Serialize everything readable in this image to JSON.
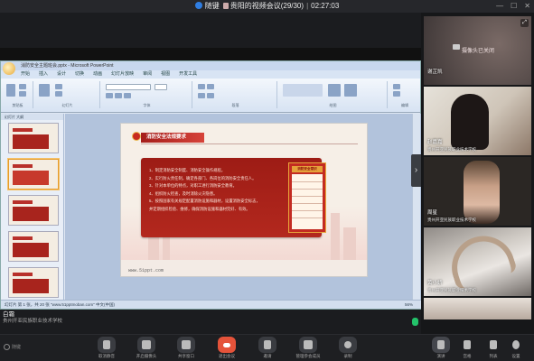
{
  "window": {
    "app_name": "随键",
    "meeting_title": "贵阳的视频会议(29/30)",
    "separator": "|",
    "elapsed": "02:27:03"
  },
  "ppt": {
    "title_text": "消防安全主题班会.pptx - Microsoft PowerPoint",
    "tabs": [
      "开始",
      "插入",
      "设计",
      "切换",
      "动画",
      "幻灯片放映",
      "审阅",
      "视图",
      "开发工具"
    ],
    "ribbon_groups": [
      "剪贴板",
      "幻灯片",
      "字体",
      "段落",
      "绘图",
      "编辑"
    ],
    "panel_tabs": "幻灯片  大纲",
    "status_left": "幻灯片 第 1 张，共 20 张   \"www.51pptmoban.com\"   中文(中国)",
    "status_zoom": "56%",
    "slide": {
      "title": "消防安全法规要求",
      "lines": [
        "1、制定消防安全制度、消防安全操作规程。",
        "2、实行防火责任制，确定各部门、各岗位的消防安全责任人。",
        "3、针对本单位的特点，对职工进行消防安全教育。",
        "4、组织防火检查，及时消除火灾隐患。",
        "5、按照国家有关规定配置消防设施和器材，设置消防安全标志，",
        "并定期组织检验、维修，确保消防设施和器材完好、有效。"
      ],
      "side_title": "消防安全常识",
      "url": "www.51ppt.com"
    }
  },
  "self_view": {
    "name": "白霜",
    "org": "贵州开亚民族职业技术学校"
  },
  "participants": [
    {
      "name": "谢芷凯",
      "org": "",
      "status": "摄像头已关闭"
    },
    {
      "name": "赵嘉嘉",
      "org": "贵州开亚民族职业技术学校",
      "status": ""
    },
    {
      "name": "周星",
      "org": "贵州开亚民族职业技术学校",
      "status": ""
    },
    {
      "name": "黄小娇",
      "org": "贵州开亚民族职业技术学校",
      "status": ""
    },
    {
      "name": "",
      "org": "",
      "status": ""
    }
  ],
  "toolbar": {
    "mute": "取消静音",
    "video": "开启摄像头",
    "share": "共享窗口",
    "leave": "退出会议",
    "invite": "邀请",
    "members": "管理参会成员",
    "record": "录制",
    "layout": "演讲",
    "gallery": "宫格",
    "list": "列表",
    "settings": "设置",
    "logo": "随键"
  },
  "colors": {
    "leave_button": "#e5533a",
    "slide_red": "#a51e1b",
    "mic_active": "#23c26a"
  }
}
